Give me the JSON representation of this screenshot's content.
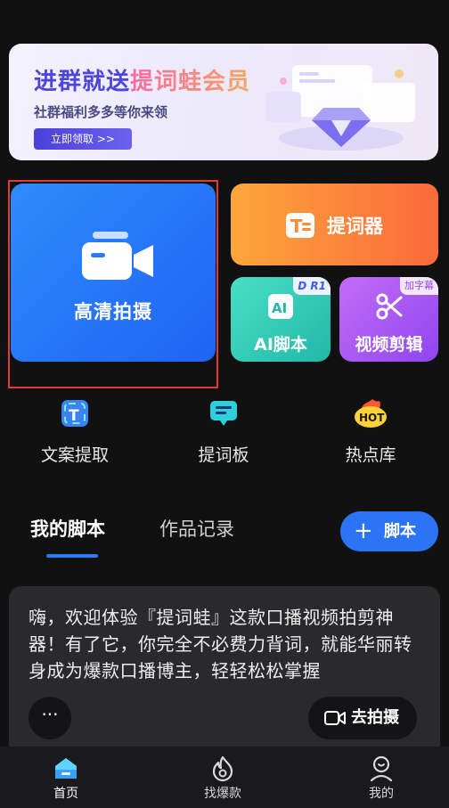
{
  "banner": {
    "title_part1": "进群就送",
    "title_part2": "提词蛙会员",
    "subtitle": "社群福利多多等你来领",
    "cta": "立即领取 >>"
  },
  "cards": {
    "shoot": {
      "label": "高清拍摄",
      "icon": "video-camera-icon"
    },
    "prompter": {
      "label": "提词器",
      "icon": "teleprompter-icon"
    },
    "ai_script": {
      "label": "AI脚本",
      "icon": "ai-icon",
      "badge": "R1"
    },
    "video_edit": {
      "label": "视频剪辑",
      "icon": "scissors-icon",
      "badge": "加字幕"
    }
  },
  "tools": [
    {
      "label": "文案提取",
      "icon": "text-extract-icon"
    },
    {
      "label": "提词板",
      "icon": "prompt-board-icon"
    },
    {
      "label": "热点库",
      "icon": "hot-icon",
      "icon_text": "HOT"
    }
  ],
  "tabs": {
    "mine": "我的脚本",
    "works": "作品记录",
    "add_script": "脚本"
  },
  "script_card": {
    "text": "嗨，欢迎体验『提词蛙』这款口播视频拍剪神器！有了它，你完全不必费力背词，就能华丽转身成为爆款口播博主，轻轻松松掌握",
    "more": "···",
    "go_shoot": "去拍摄"
  },
  "bottom_nav": [
    {
      "label": "首页",
      "icon": "home-icon",
      "active": true
    },
    {
      "label": "找爆款",
      "icon": "flame-icon",
      "active": false
    },
    {
      "label": "我的",
      "icon": "profile-icon",
      "active": false
    }
  ],
  "colors": {
    "accent_blue": "#2a74f5",
    "prompter_orange": "#fb6a3b",
    "ai_teal": "#20b8a6",
    "edit_purple": "#8f45ef",
    "highlight_red": "#e13a3a"
  }
}
